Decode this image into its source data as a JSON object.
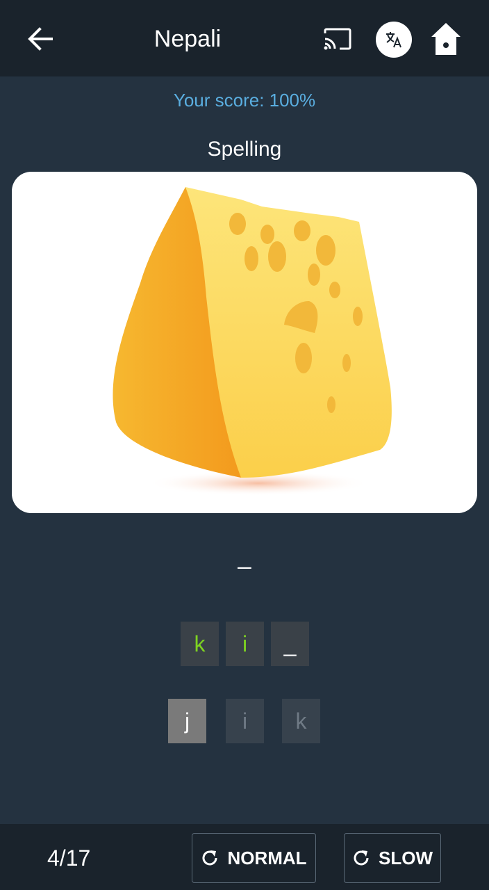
{
  "header": {
    "title": "Nepali",
    "icons": [
      "back-arrow-icon",
      "cast-icon",
      "translate-icon",
      "home-icon"
    ]
  },
  "score_text": "Your score: 100%",
  "mode_label": "Spelling",
  "image": {
    "subject": "cheese-wedge"
  },
  "answer_dash": "_",
  "answer_slots": [
    {
      "letter": "k",
      "state": "correct"
    },
    {
      "letter": "i",
      "state": "correct"
    },
    {
      "letter": "_",
      "state": "empty"
    }
  ],
  "letter_choices": [
    {
      "letter": "j",
      "state": "available"
    },
    {
      "letter": "i",
      "state": "used"
    },
    {
      "letter": "k",
      "state": "used"
    }
  ],
  "footer": {
    "progress": "4/17",
    "normal_label": "NORMAL",
    "slow_label": "SLOW"
  },
  "colors": {
    "background": "#243240",
    "bar": "#1a232c",
    "score": "#5aaee0",
    "correct_letter": "#7ed321"
  }
}
